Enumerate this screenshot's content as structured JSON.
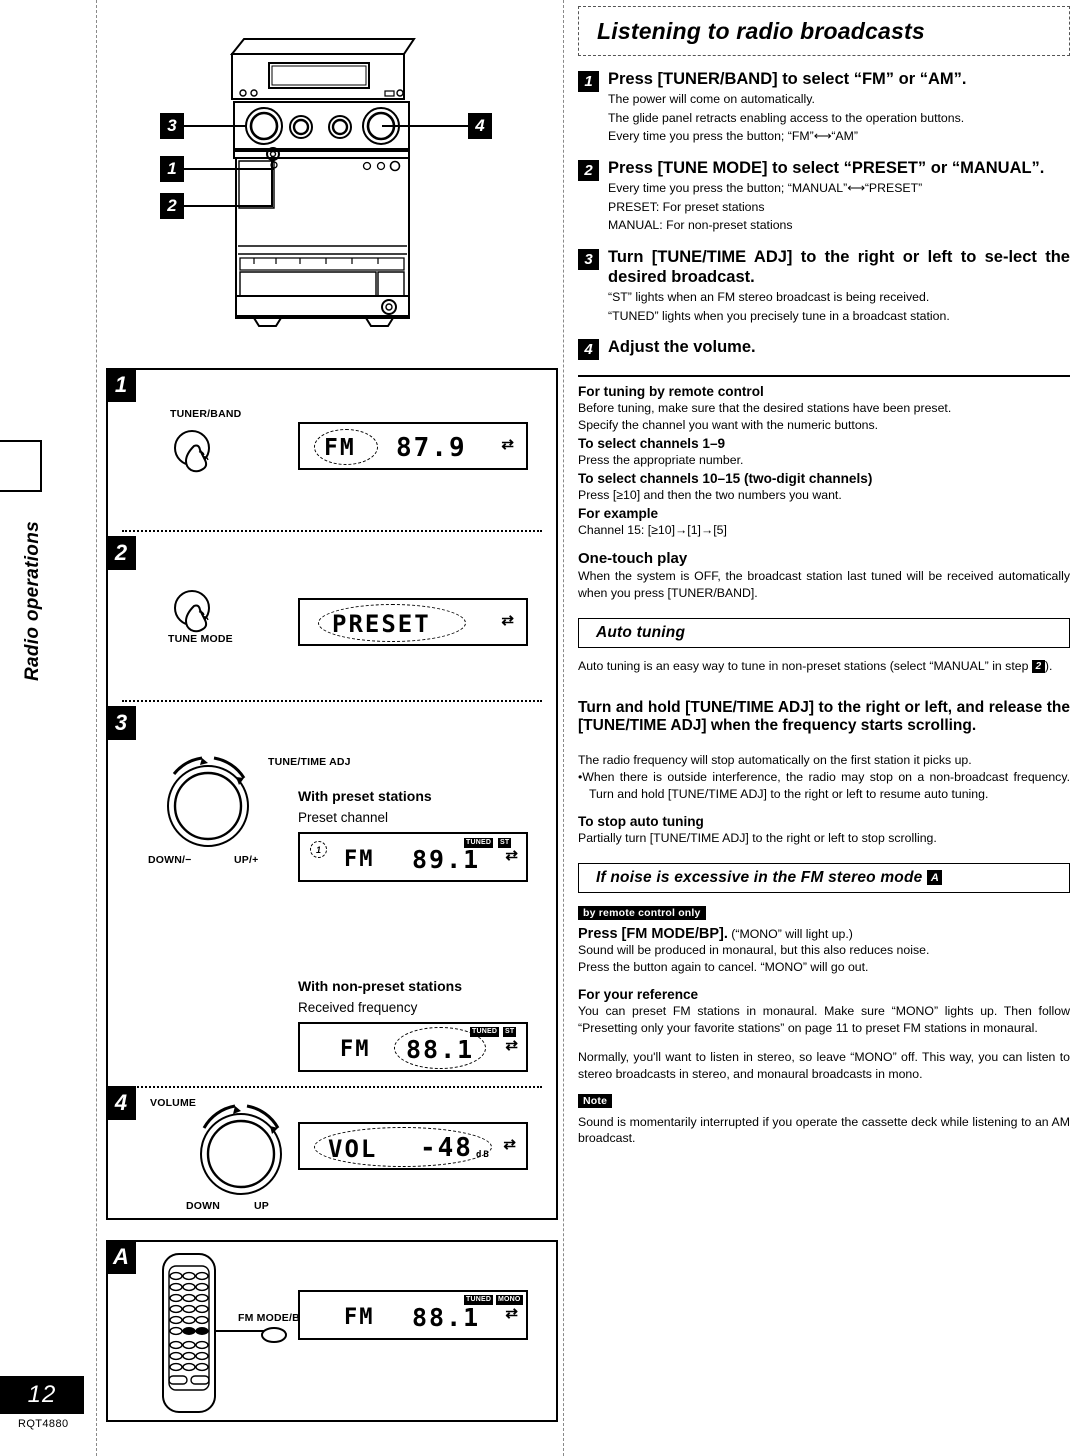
{
  "page": {
    "number": "12",
    "product_code": "RQT4880",
    "side_tab_label": "Radio operations"
  },
  "right": {
    "title": "Listening to radio broadcasts",
    "steps": [
      {
        "num": "1",
        "heading": "Press [TUNER/BAND] to select “FM” or “AM”.",
        "lines": [
          "The power will come on automatically.",
          "The glide panel retracts enabling access to the operation buttons.",
          "Every time you press the button; “FM”⟷“AM”"
        ]
      },
      {
        "num": "2",
        "heading": "Press [TUNE MODE] to select “PRESET” or “MANUAL”.",
        "lines": [
          "Every time you press the button; “MANUAL”⟷“PRESET”",
          "PRESET:  For preset stations",
          "MANUAL: For non-preset stations"
        ]
      },
      {
        "num": "3",
        "heading": "Turn [TUNE/TIME ADJ] to the right or left to se-lect the desired broadcast.",
        "lines": [
          "“ST” lights when an FM stereo broadcast is being received.",
          "“TUNED” lights when you precisely tune in a broadcast station."
        ]
      },
      {
        "num": "4",
        "heading": "Adjust the volume.",
        "lines": []
      }
    ],
    "remote_tuning": {
      "heading": "For tuning by remote control",
      "intro_1": "Before tuning, make sure that the desired stations have been preset.",
      "intro_2": "Specify the channel you want with the numeric buttons.",
      "sub1_head": "To select channels 1–9",
      "sub1_body": "Press the appropriate number.",
      "sub2_head": "To select channels 10–15 (two-digit channels)",
      "sub2_body": "Press [≥10] and then the two numbers you want.",
      "sub3_head": "For example",
      "sub3_body": "Channel 15:  [≥10]→[1]→[5]"
    },
    "one_touch": {
      "heading": "One-touch play",
      "body": "When the system is OFF, the broadcast station last tuned will be received automatically when you press [TUNER/BAND]."
    },
    "auto_tuning": {
      "box_title": "Auto tuning",
      "intro_a": "Auto tuning is an easy way to tune in non-preset stations (select “MANUAL” in step ",
      "intro_badge": "2",
      "intro_b": ").",
      "bold_instruction": "Turn and hold [TUNE/TIME ADJ] to the right or left, and release the [TUNE/TIME ADJ] when the frequency starts scrolling.",
      "body_1": "The radio frequency will stop automatically on the first station it picks up.",
      "bullet_1": "•When there is outside interference, the radio may stop on a non-broadcast frequency. Turn and hold [TUNE/TIME ADJ] to the right or left to resume auto tuning.",
      "stop_head": "To stop auto tuning",
      "stop_body": "Partially turn [TUNE/TIME ADJ] to the right or left to stop scrolling."
    },
    "fm_noise": {
      "box_title": "If noise is excessive in the FM stereo mode",
      "box_badge": "A",
      "tag": "by remote control only",
      "lead_bold": "Press [FM MODE/BP].",
      "lead_rest": " (“MONO” will light up.)",
      "body_1": "Sound will be produced in monaural, but this also reduces noise.",
      "body_2": "Press the button again to cancel. “MONO” will go out.",
      "ref_head": "For your reference",
      "ref_body": "You can preset FM stations in monaural. Make sure “MONO” lights up. Then follow “Presetting only your favorite stations” on page 11 to preset FM stations in monaural.",
      "normal_body": "Normally, you'll want to listen in stereo, so leave “MONO” off. This way, you can listen to stereo broadcasts in stereo, and monaural broadcasts in mono.",
      "note_tag": "Note",
      "note_body": "Sound is momentarily interrupted if you operate the cassette deck while listening to an AM broadcast."
    }
  },
  "left": {
    "illustration_callouts": [
      "3",
      "1",
      "2",
      "4"
    ],
    "steps": [
      {
        "badge": "1",
        "control_label": "TUNER/BAND",
        "display": {
          "mode": "FM",
          "value": "87.9",
          "highlight": "FM"
        }
      },
      {
        "badge": "2",
        "control_label": "TUNE MODE",
        "display": {
          "value": "PRESET",
          "highlight": "PRESET"
        }
      },
      {
        "badge": "3",
        "control_label": "TUNE/TIME ADJ",
        "knob_left": "DOWN/−",
        "knob_right": "UP/+",
        "preset_caption_bold": "With preset stations",
        "preset_caption_plain": "Preset channel",
        "preset_display": {
          "channel": "1",
          "mode": "FM",
          "value": "89.1",
          "indicators": [
            "TUNED",
            "ST"
          ]
        },
        "nonpreset_caption_bold": "With non-preset stations",
        "nonpreset_caption_plain": "Received frequency",
        "nonpreset_display": {
          "mode": "FM",
          "value": "88.1",
          "indicators": [
            "TUNED",
            "ST"
          ],
          "highlight": "88.1"
        }
      },
      {
        "badge": "4",
        "control_label": "VOLUME",
        "knob_left": "DOWN",
        "knob_right": "UP",
        "display": {
          "label": "VOL",
          "value": "-48",
          "unit": "dB"
        }
      }
    ],
    "remote_panel": {
      "badge": "A",
      "button_label": "FM MODE/BP",
      "display": {
        "mode": "FM",
        "value": "88.1",
        "indicators": [
          "TUNED",
          "MONO"
        ]
      }
    }
  }
}
